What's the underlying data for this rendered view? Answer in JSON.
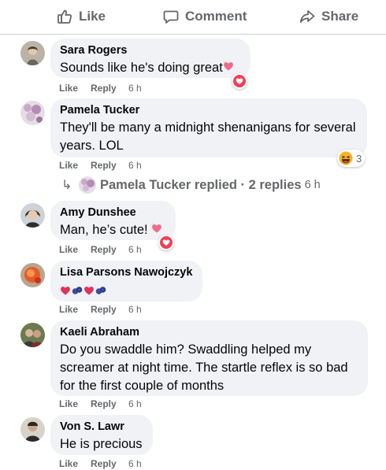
{
  "actions": {
    "like": "Like",
    "comment": "Comment",
    "share": "Share"
  },
  "meta_labels": {
    "like": "Like",
    "reply": "Reply"
  },
  "comments": [
    {
      "author": "Sara Rogers",
      "text": "Sounds like he's doing great",
      "time": "6 h",
      "reaction": "heart"
    },
    {
      "author": "Pamela Tucker",
      "text": "They'll be many a midnight shenanigans for several years. LOL",
      "time": "6 h",
      "reaction": "haha",
      "reaction_count": "3"
    },
    {
      "author": "Amy Dunshee",
      "text": "Man, he’s cute!",
      "time": "6 h",
      "reaction": "heart"
    },
    {
      "author": "Lisa Parsons Nawojczyk",
      "text": "",
      "time": "6 h"
    },
    {
      "author": "Kaeli Abraham",
      "text": "Do you swaddle him? Swaddling helped my screamer at night time. The startle reflex is so bad for the first couple of months",
      "time": "6 h"
    },
    {
      "author": "Von S. Lawr",
      "text": "He is precious",
      "time": "6 h"
    }
  ],
  "replies_summary": {
    "text": "Pamela Tucker replied · 2 replies",
    "time": "6 h"
  },
  "colors": {
    "bubble": "#f0f2f5",
    "secondary_text": "#65676b",
    "heart": "#f33e58",
    "divider": "#ced0d4"
  }
}
